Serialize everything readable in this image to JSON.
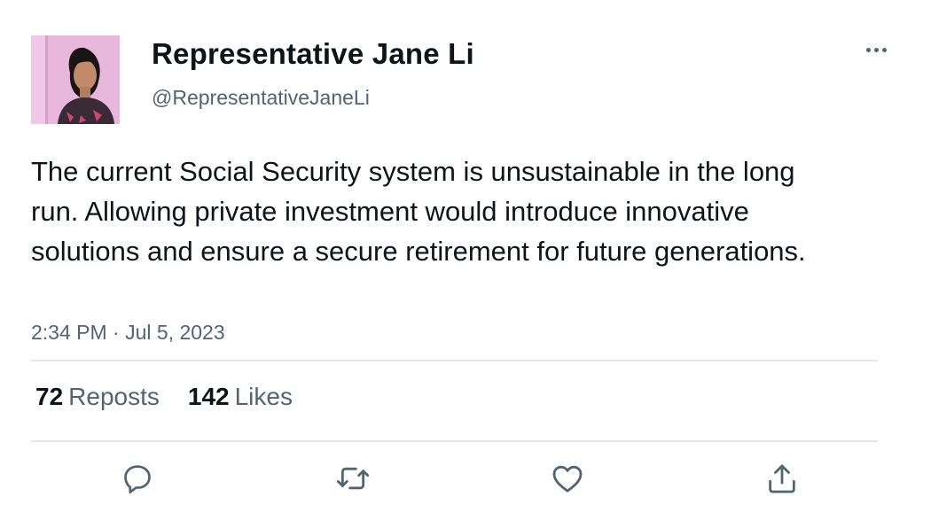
{
  "author": {
    "display_name": "Representative Jane Li",
    "handle": "@RepresentativeJaneLi"
  },
  "tweet": {
    "text": "The current Social Security system is unsustainable in the long run. Allowing private investment would introduce innovative solutions and ensure a secure retirement for future generations.",
    "timestamp": "2:34 PM · Jul 5, 2023"
  },
  "stats": {
    "reposts_count": "72",
    "reposts_label": "Reposts",
    "likes_count": "142",
    "likes_label": "Likes"
  },
  "icons": {
    "more": "more-horizontal-icon",
    "reply": "reply-icon",
    "repost": "repost-icon",
    "like": "heart-icon",
    "share": "share-icon"
  },
  "colors": {
    "text": "#0f1419",
    "secondary": "#536471",
    "divider": "#e1e6ea",
    "avatar_bg": "#e9b9dc"
  }
}
